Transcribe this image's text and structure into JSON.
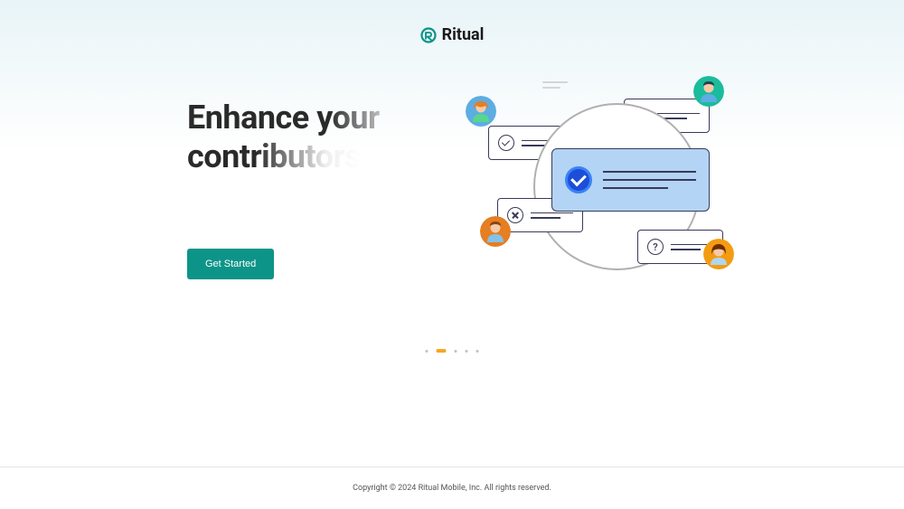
{
  "brand": {
    "name": "Ritual",
    "accent_color": "#0d9488"
  },
  "hero": {
    "headline_word1": "Enhance",
    "headline_word2": "your",
    "headline_word3": "contributors",
    "cta_label": "Get Started"
  },
  "carousel": {
    "total_slides": 5,
    "active_index": 1
  },
  "footer": {
    "copyright": "Copyright © 2024 Ritual Mobile, Inc. All rights reserved."
  }
}
